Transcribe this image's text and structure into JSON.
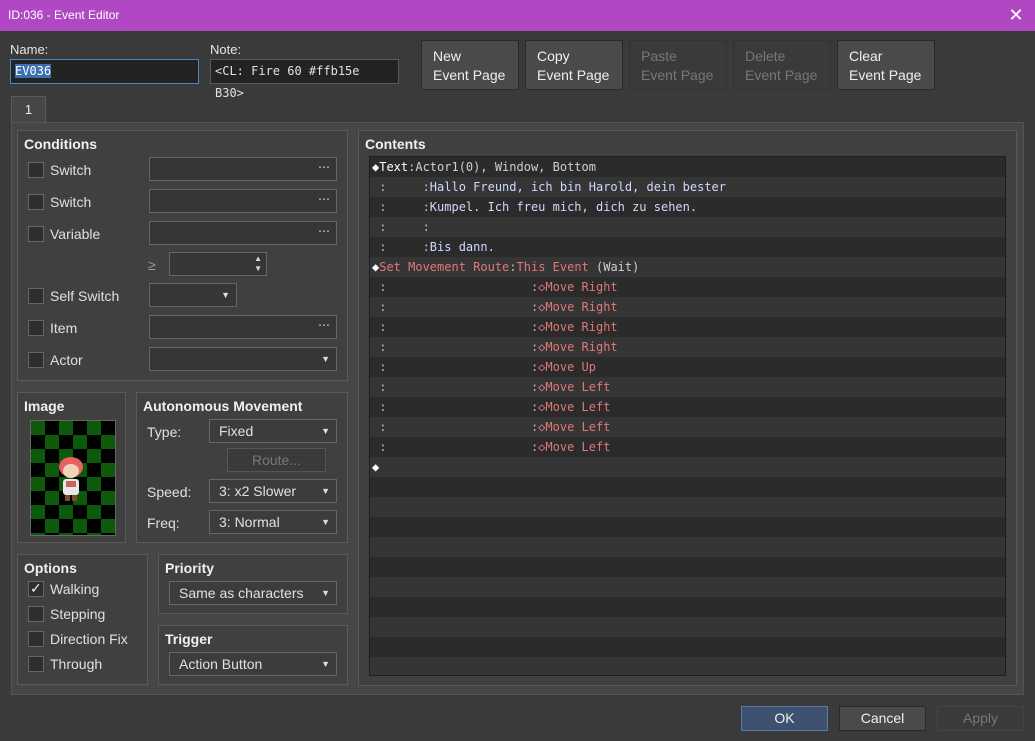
{
  "window": {
    "title": "ID:036 - Event Editor",
    "close_glyph": "✕"
  },
  "name_label": "Name:",
  "name_value": "EV036",
  "note_label": "Note:",
  "note_value": "<CL: Fire 60 #ffb15e B30>",
  "toolbar": [
    {
      "line1": "New",
      "line2": "Event Page",
      "enabled": true
    },
    {
      "line1": "Copy",
      "line2": "Event Page",
      "enabled": true
    },
    {
      "line1": "Paste",
      "line2": "Event Page",
      "enabled": false
    },
    {
      "line1": "Delete",
      "line2": "Event Page",
      "enabled": false
    },
    {
      "line1": "Clear",
      "line2": "Event Page",
      "enabled": true
    }
  ],
  "page_tab": "1",
  "conditions": {
    "title": "Conditions",
    "switch1": "Switch",
    "switch2": "Switch",
    "variable": "Variable",
    "gte": "≥",
    "self_switch": "Self Switch",
    "item": "Item",
    "actor": "Actor",
    "dots": "⋯",
    "arrow": "▼",
    "spin": "▲\n▼"
  },
  "image": {
    "title": "Image",
    "icon": "character-sprite-icon"
  },
  "movement": {
    "title": "Autonomous Movement",
    "type_label": "Type:",
    "type_value": "Fixed",
    "route_button": "Route...",
    "speed_label": "Speed:",
    "speed_value": "3: x2 Slower",
    "freq_label": "Freq:",
    "freq_value": "3: Normal"
  },
  "options": {
    "title": "Options",
    "walking": "Walking",
    "stepping": "Stepping",
    "direction_fix": "Direction Fix",
    "through": "Through"
  },
  "priority": {
    "title": "Priority",
    "value": "Same as characters"
  },
  "trigger": {
    "title": "Trigger",
    "value": "Action Button"
  },
  "contents": {
    "title": "Contents",
    "rows": [
      {
        "parts": [
          [
            "c-t",
            "◆Text"
          ],
          [
            "c-h",
            ":"
          ],
          [
            "c-h",
            "Actor1(0), Window, Bottom"
          ]
        ]
      },
      {
        "parts": [
          [
            "c-g",
            " :     :"
          ],
          [
            "c-text",
            "Hallo Freund, ich bin Harold, dein bester"
          ]
        ]
      },
      {
        "parts": [
          [
            "c-g",
            " :     :"
          ],
          [
            "c-text",
            "Kumpel. Ich freu mich, dich zu sehen."
          ]
        ]
      },
      {
        "parts": [
          [
            "c-g",
            " :     :"
          ],
          [
            "c-text",
            ""
          ]
        ]
      },
      {
        "parts": [
          [
            "c-g",
            " :     :"
          ],
          [
            "c-text",
            "Bis dann."
          ]
        ]
      },
      {
        "parts": [
          [
            "c-t",
            "◆"
          ],
          [
            "c-mv",
            "Set Movement Route"
          ],
          [
            "c-g",
            ":"
          ],
          [
            "c-mv",
            "This Event"
          ],
          [
            "c-h",
            " (Wait)"
          ]
        ]
      },
      {
        "parts": [
          [
            "c-g",
            " :                    :"
          ],
          [
            "c-mv",
            "◇Move Right"
          ]
        ]
      },
      {
        "parts": [
          [
            "c-g",
            " :                    :"
          ],
          [
            "c-mv",
            "◇Move Right"
          ]
        ]
      },
      {
        "parts": [
          [
            "c-g",
            " :                    :"
          ],
          [
            "c-mv",
            "◇Move Right"
          ]
        ]
      },
      {
        "parts": [
          [
            "c-g",
            " :                    :"
          ],
          [
            "c-mv",
            "◇Move Right"
          ]
        ]
      },
      {
        "parts": [
          [
            "c-g",
            " :                    :"
          ],
          [
            "c-mv",
            "◇Move Up"
          ]
        ]
      },
      {
        "parts": [
          [
            "c-g",
            " :                    :"
          ],
          [
            "c-mv",
            "◇Move Left"
          ]
        ]
      },
      {
        "parts": [
          [
            "c-g",
            " :                    :"
          ],
          [
            "c-mv",
            "◇Move Left"
          ]
        ]
      },
      {
        "parts": [
          [
            "c-g",
            " :                    :"
          ],
          [
            "c-mv",
            "◇Move Left"
          ]
        ]
      },
      {
        "parts": [
          [
            "c-g",
            " :                    :"
          ],
          [
            "c-mv",
            "◇Move Left"
          ]
        ]
      },
      {
        "parts": [
          [
            "c-t",
            "◆"
          ]
        ]
      }
    ]
  },
  "buttons": {
    "ok": "OK",
    "cancel": "Cancel",
    "apply": "Apply"
  }
}
